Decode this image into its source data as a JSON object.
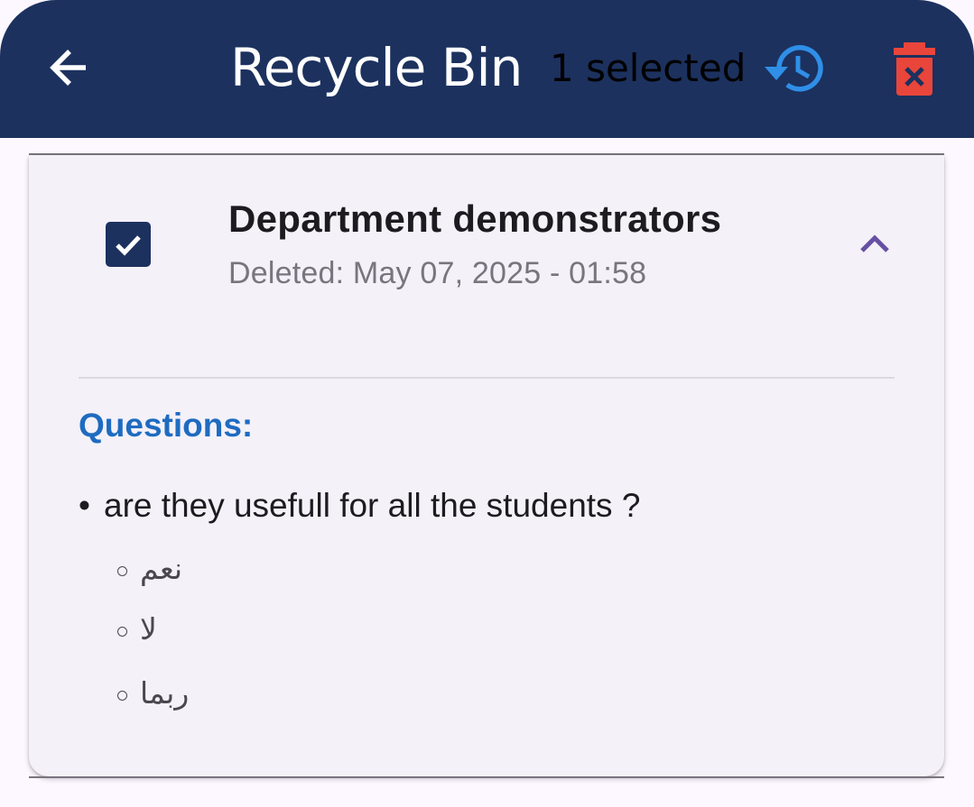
{
  "app_bar": {
    "title": "Recycle Bin",
    "selection_count": "1 selected",
    "icons": {
      "back": "arrow-left-icon",
      "restore": "history-restore-icon",
      "delete": "trash-x-icon"
    },
    "colors": {
      "background": "#1c315e",
      "restore": "#2f8fe8",
      "delete": "#e9453b"
    }
  },
  "item": {
    "title": "Department demonstrators",
    "deleted_label": "Deleted: May 07, 2025 - 01:58",
    "selected": true,
    "expanded": true,
    "questions_heading": "Questions:",
    "questions": [
      {
        "text": "are they usefull for all the students ?",
        "options": [
          "نعم",
          "لا",
          "ربما"
        ]
      }
    ],
    "colors": {
      "heading": "#1e6bc1",
      "chevron": "#6750a4"
    }
  }
}
